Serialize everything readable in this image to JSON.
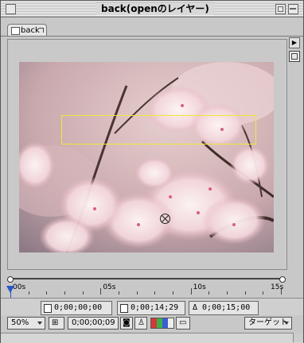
{
  "window": {
    "title": "back(openのレイヤー)"
  },
  "tab": {
    "label": "back"
  },
  "timeline": {
    "ruler_labels": [
      "00s",
      "05s",
      "10s",
      "15s"
    ],
    "current_fraction": 0.0
  },
  "info": {
    "in_point": "0;00;00;00",
    "out_point": "0;00;14;29",
    "duration": "Δ 0;00;15;00"
  },
  "controls": {
    "zoom": "50%",
    "timecode": "0;00;00;09",
    "target": "ターゲット"
  },
  "colors": {
    "channel_red": "#d23a3a",
    "channel_green": "#3bb14a",
    "channel_blue": "#3a5fd2",
    "mask_box": "#f0e838",
    "playhead": "#2a55c7"
  }
}
